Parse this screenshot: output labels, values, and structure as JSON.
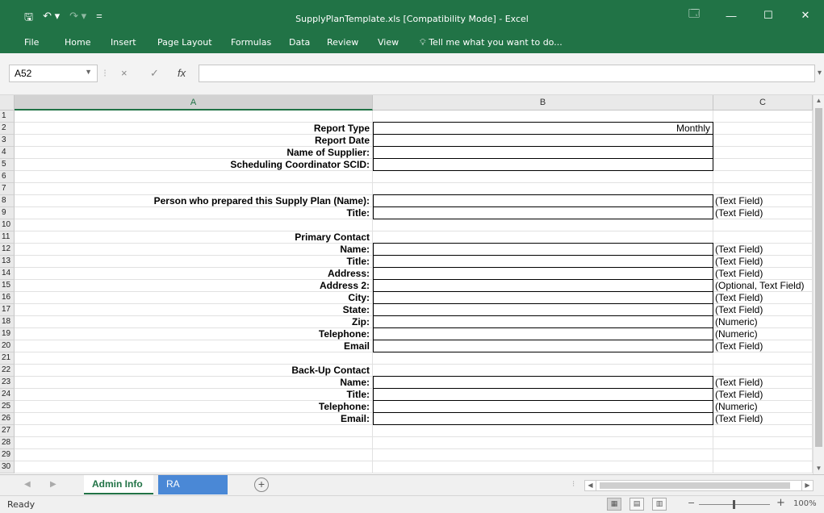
{
  "app": {
    "title": "SupplyPlanTemplate.xls  [Compatibility Mode]  -  Excel",
    "qat": {
      "save": "🖫",
      "undo": "↶ ▾",
      "redo": "↷ ▾",
      "customize": "="
    },
    "window_buttons": {
      "ribbon_display": "🗔",
      "minimize": "—",
      "maximize": "☐",
      "close": "✕"
    }
  },
  "ribbon": {
    "tabs": [
      "File",
      "Home",
      "Insert",
      "Page Layout",
      "Formulas",
      "Data",
      "Review",
      "View"
    ],
    "tell_me": "Tell me what you want to do..."
  },
  "formula_bar": {
    "name_box": "A52",
    "cancel": "×",
    "enter": "✓",
    "fx": "fx",
    "formula": ""
  },
  "columns": [
    "A",
    "B",
    "C"
  ],
  "rows": [
    {
      "n": "1",
      "a": "",
      "b": "",
      "c": "",
      "box": false
    },
    {
      "n": "2",
      "a": "Report Type",
      "b": "Monthly",
      "c": "",
      "box": true
    },
    {
      "n": "3",
      "a": "Report Date",
      "b": "",
      "c": "",
      "box": true
    },
    {
      "n": "4",
      "a": "Name of Supplier:",
      "b": "",
      "c": "",
      "box": true
    },
    {
      "n": "5",
      "a": "Scheduling Coordinator SCID:",
      "b": "",
      "c": "",
      "box": true
    },
    {
      "n": "6",
      "a": "",
      "b": "",
      "c": "",
      "box": false
    },
    {
      "n": "7",
      "a": "",
      "b": "",
      "c": "",
      "box": false
    },
    {
      "n": "8",
      "a": "Person who prepared this Supply Plan (Name):",
      "b": "",
      "c": "(Text Field)",
      "box": true
    },
    {
      "n": "9",
      "a": "Title:",
      "b": "",
      "c": "(Text Field)",
      "box": true
    },
    {
      "n": "10",
      "a": "",
      "b": "",
      "c": "",
      "box": false
    },
    {
      "n": "11",
      "a": "Primary Contact",
      "b": "",
      "c": "",
      "box": false
    },
    {
      "n": "12",
      "a": "Name:",
      "b": "",
      "c": "(Text Field)",
      "box": true
    },
    {
      "n": "13",
      "a": "Title:",
      "b": "",
      "c": "(Text Field)",
      "box": true
    },
    {
      "n": "14",
      "a": "Address:",
      "b": "",
      "c": "(Text Field)",
      "box": true
    },
    {
      "n": "15",
      "a": "Address 2:",
      "b": "",
      "c": "(Optional, Text Field)",
      "box": true
    },
    {
      "n": "16",
      "a": "City:",
      "b": "",
      "c": "(Text Field)",
      "box": true
    },
    {
      "n": "17",
      "a": "State:",
      "b": "",
      "c": "(Text Field)",
      "box": true
    },
    {
      "n": "18",
      "a": "Zip:",
      "b": "",
      "c": "(Numeric)",
      "box": true
    },
    {
      "n": "19",
      "a": "Telephone:",
      "b": "",
      "c": "(Numeric)",
      "box": true
    },
    {
      "n": "20",
      "a": "Email",
      "b": "",
      "c": "(Text Field)",
      "box": true
    },
    {
      "n": "21",
      "a": "",
      "b": "",
      "c": "",
      "box": false
    },
    {
      "n": "22",
      "a": "Back-Up Contact",
      "b": "",
      "c": "",
      "box": false
    },
    {
      "n": "23",
      "a": "Name:",
      "b": "",
      "c": "(Text Field)",
      "box": true
    },
    {
      "n": "24",
      "a": "Title:",
      "b": "",
      "c": "(Text Field)",
      "box": true
    },
    {
      "n": "25",
      "a": "Telephone:",
      "b": "",
      "c": "(Numeric)",
      "box": true
    },
    {
      "n": "26",
      "a": "Email:",
      "b": "",
      "c": "(Text Field)",
      "box": true
    },
    {
      "n": "27",
      "a": "",
      "b": "",
      "c": "",
      "box": false
    },
    {
      "n": "28",
      "a": "",
      "b": "",
      "c": "",
      "box": false
    },
    {
      "n": "29",
      "a": "",
      "b": "",
      "c": "",
      "box": false
    },
    {
      "n": "30",
      "a": "",
      "b": "",
      "c": "",
      "box": false
    }
  ],
  "sheets": {
    "tabs": [
      "Admin Info",
      "RA Capacity"
    ],
    "active": "Admin Info",
    "add": "+"
  },
  "status": {
    "ready": "Ready",
    "zoom": "100%",
    "zoom_minus": "−",
    "zoom_plus": "+"
  },
  "colors": {
    "excel_green": "#217346",
    "ra_tab": "#4a88d6"
  }
}
